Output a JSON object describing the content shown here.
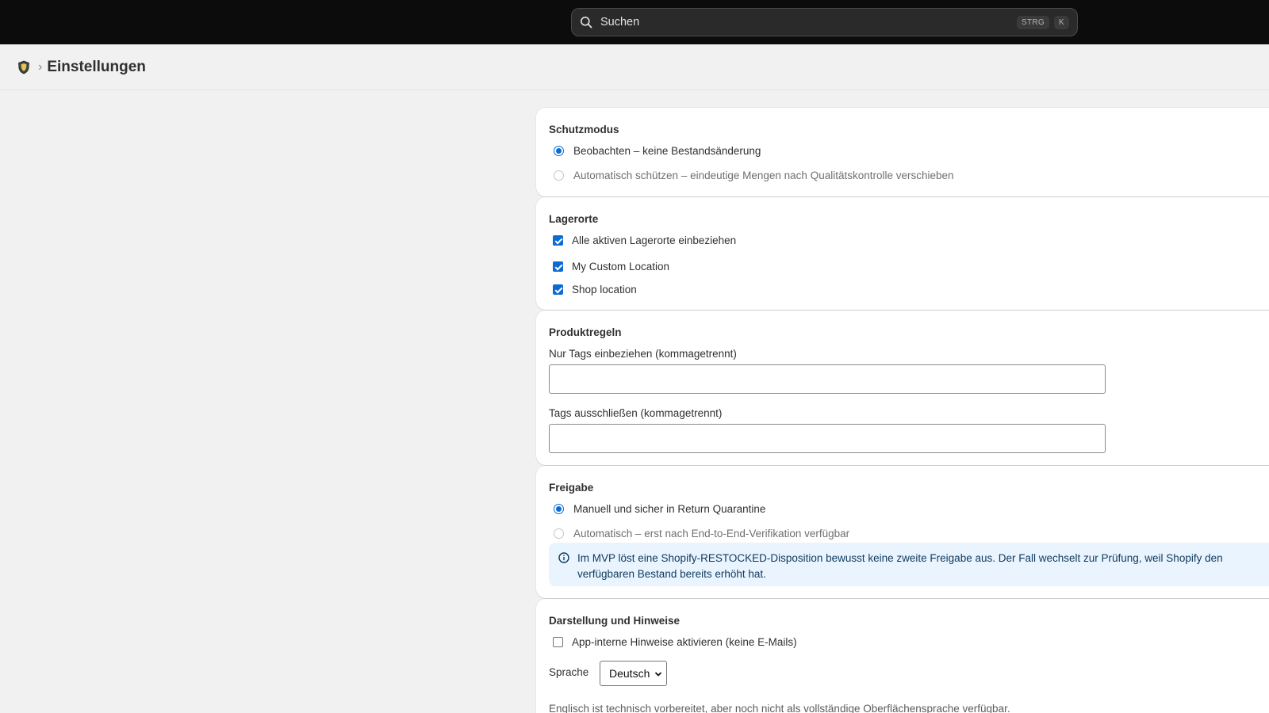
{
  "topbar": {
    "search": {
      "placeholder": "Suchen",
      "shortcut_modifier": "STRG",
      "shortcut_key": "K"
    }
  },
  "header": {
    "breadcrumb_separator": "›",
    "title": "Einstellungen"
  },
  "sections": {
    "protection": {
      "title": "Schutzmodus",
      "options": [
        {
          "label": "Beobachten – keine Bestandsänderung",
          "selected": true
        },
        {
          "label": "Automatisch schützen – eindeutige Mengen nach Qualitätskontrolle verschieben",
          "selected": false,
          "disabled": true
        }
      ]
    },
    "locations": {
      "title": "Lagerorte",
      "items": [
        {
          "label": "Alle aktiven Lagerorte einbeziehen",
          "checked": true
        },
        {
          "label": "My Custom Location",
          "checked": true
        },
        {
          "label": "Shop location",
          "checked": true
        }
      ]
    },
    "product_rules": {
      "title": "Produktregeln",
      "include_tags_label": "Nur Tags einbeziehen (kommagetrennt)",
      "include_tags_value": "",
      "exclude_tags_label": "Tags ausschließen (kommagetrennt)",
      "exclude_tags_value": ""
    },
    "release": {
      "title": "Freigabe",
      "options": [
        {
          "label": "Manuell und sicher in Return Quarantine",
          "selected": true
        },
        {
          "label": "Automatisch – erst nach End-to-End-Verifikation verfügbar",
          "selected": false,
          "disabled": true
        }
      ],
      "info_line1": "Im MVP löst eine Shopify-RESTOCKED-Disposition bewusst keine zweite Freigabe aus. Der Fall wechselt zur Prüfung, weil Shopify den",
      "info_line2": "verfügbaren Bestand bereits erhöht hat."
    },
    "display": {
      "title": "Darstellung und Hinweise",
      "inapp_notice_label": "App-interne Hinweise aktivieren (keine E-Mails)",
      "inapp_notice_checked": false,
      "language_label": "Sprache",
      "language_value": "Deutsch",
      "language_hint": "Englisch ist technisch vorbereitet, aber noch nicht als vollständige Oberflächensprache verfügbar."
    }
  },
  "colors": {
    "topbar": "#0c0c0c",
    "accent": "#0b6bd3",
    "info_bg": "#eaf4ff",
    "page_bg": "#f1f1f1"
  }
}
